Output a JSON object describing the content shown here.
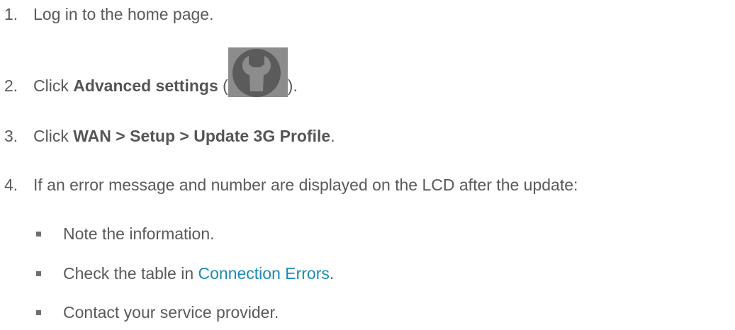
{
  "steps": [
    {
      "number": "1.",
      "text": "Log in to the home page."
    },
    {
      "number": "2.",
      "prefix": "Click ",
      "bold": "Advanced settings",
      "open_paren": " (",
      "icon": "wrench-icon",
      "close": ")."
    },
    {
      "number": "3.",
      "prefix": "Click ",
      "bold": "WAN > Setup > Update 3G Profile",
      "suffix": "."
    },
    {
      "number": "4.",
      "text": "If an error message and number are displayed on the LCD after the update:"
    }
  ],
  "sub_items": [
    {
      "text": "Note the information."
    },
    {
      "prefix": "Check the table in ",
      "link": "Connection Errors",
      "suffix": "."
    },
    {
      "text": "Contact your service provider."
    }
  ],
  "colors": {
    "text": "#595959",
    "link": "#1d8ab0",
    "icon_bg": "#8a8a8a",
    "icon_fg": "#5a5a5a"
  }
}
